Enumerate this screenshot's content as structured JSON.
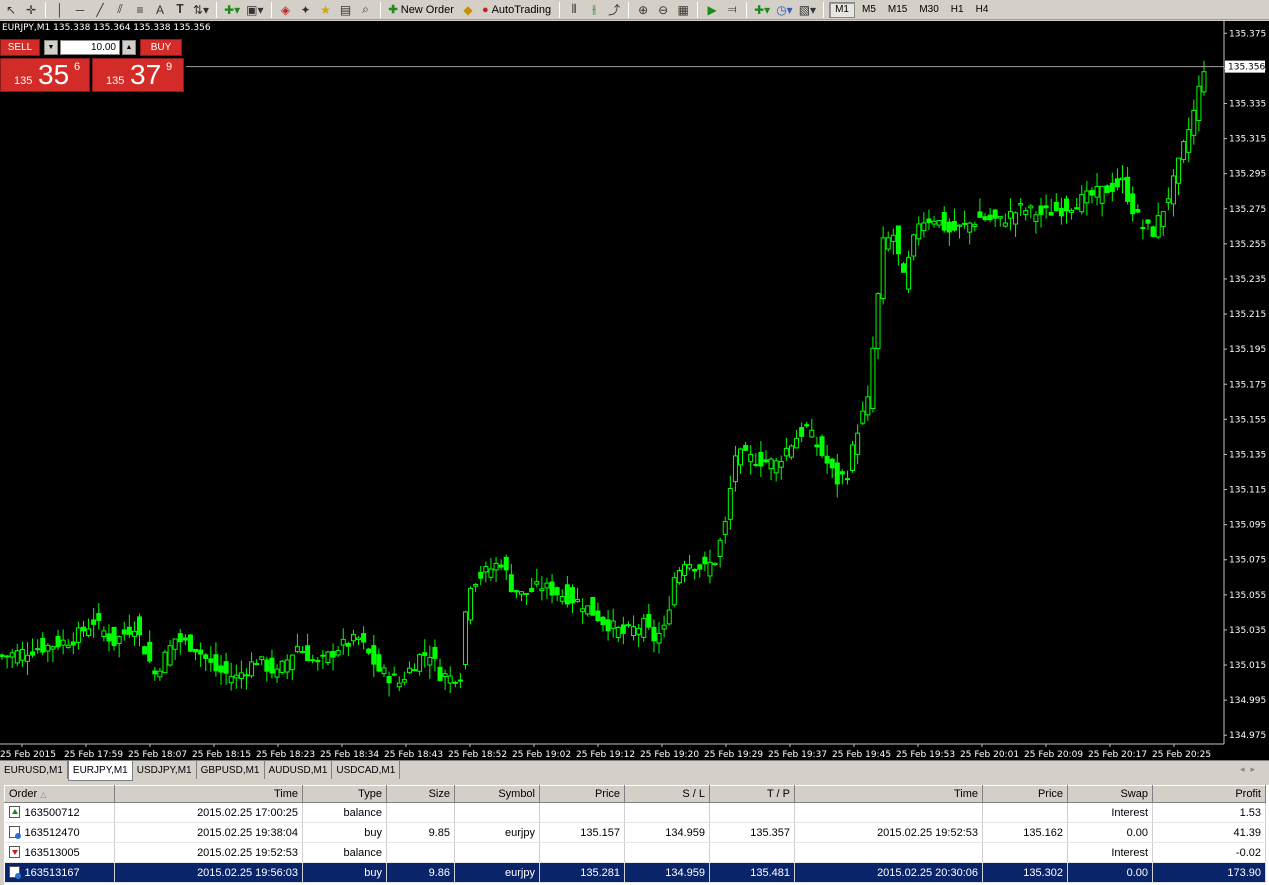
{
  "toolbar": {
    "new_order_label": "New Order",
    "autotrading_label": "AutoTrading",
    "timeframes": [
      "M1",
      "M5",
      "M15",
      "M30",
      "H1",
      "H4"
    ],
    "active_timeframe": "M1"
  },
  "chart": {
    "title_line": "EURJPY,M1  135.338 135.364 135.338 135.356",
    "current_price_label": "135.356",
    "background": "#000000",
    "candle_color": "#00ff00",
    "grid": false
  },
  "one_click": {
    "sell_label": "SELL",
    "buy_label": "BUY",
    "lot_value": "10.00",
    "sell_price": {
      "prefix": "135",
      "big": "35",
      "sup": "6"
    },
    "buy_price": {
      "prefix": "135",
      "big": "37",
      "sup": "9"
    },
    "button_color": "#d32b27"
  },
  "chart_data": {
    "type": "candlestick",
    "symbol": "EURJPY",
    "timeframe": "M1",
    "y_ticks": [
      "135.375",
      "135.355",
      "135.335",
      "135.315",
      "135.295",
      "135.275",
      "135.255",
      "135.235",
      "135.215",
      "135.195",
      "135.175",
      "135.155",
      "135.135",
      "135.115",
      "135.095",
      "135.075",
      "135.055",
      "135.035",
      "135.015",
      "134.995",
      "134.975"
    ],
    "ylim": [
      134.97,
      135.382
    ],
    "x_tick_labels": [
      "25 Feb 2015",
      "25 Feb 17:59",
      "25 Feb 18:07",
      "25 Feb 18:15",
      "25 Feb 18:23",
      "25 Feb 18:34",
      "25 Feb 18:43",
      "25 Feb 18:52",
      "25 Feb 19:02",
      "25 Feb 19:12",
      "25 Feb 19:20",
      "25 Feb 19:29",
      "25 Feb 19:37",
      "25 Feb 19:45",
      "25 Feb 19:53",
      "25 Feb 20:01",
      "25 Feb 20:09",
      "25 Feb 20:17",
      "25 Feb 20:25"
    ],
    "current_price": 135.356,
    "anchors": [
      [
        0,
        135.02
      ],
      [
        8,
        135.025
      ],
      [
        14,
        135.03
      ],
      [
        18,
        135.04
      ],
      [
        22,
        135.028
      ],
      [
        26,
        135.038
      ],
      [
        30,
        135.01
      ],
      [
        34,
        135.03
      ],
      [
        38,
        135.025
      ],
      [
        42,
        135.012
      ],
      [
        46,
        135.008
      ],
      [
        50,
        135.018
      ],
      [
        54,
        135.01
      ],
      [
        58,
        135.026
      ],
      [
        62,
        135.015
      ],
      [
        66,
        135.025
      ],
      [
        70,
        135.03
      ],
      [
        74,
        135.012
      ],
      [
        78,
        135.005
      ],
      [
        82,
        135.02
      ],
      [
        84,
        135.022
      ],
      [
        86,
        135.01
      ],
      [
        88,
        135.008
      ],
      [
        90,
        135.01
      ],
      [
        91,
        135.045
      ],
      [
        92,
        135.062
      ],
      [
        95,
        135.068
      ],
      [
        98,
        135.074
      ],
      [
        100,
        135.06
      ],
      [
        102,
        135.055
      ],
      [
        106,
        135.06
      ],
      [
        110,
        135.055
      ],
      [
        114,
        135.05
      ],
      [
        118,
        135.04
      ],
      [
        122,
        135.033
      ],
      [
        126,
        135.038
      ],
      [
        128,
        135.03
      ],
      [
        130,
        135.035
      ],
      [
        132,
        135.065
      ],
      [
        134,
        135.075
      ],
      [
        136,
        135.072
      ],
      [
        138,
        135.07
      ],
      [
        140,
        135.075
      ],
      [
        142,
        135.095
      ],
      [
        144,
        135.135
      ],
      [
        148,
        135.132
      ],
      [
        152,
        135.13
      ],
      [
        154,
        135.138
      ],
      [
        156,
        135.145
      ],
      [
        158,
        135.15
      ],
      [
        160,
        135.14
      ],
      [
        162,
        135.13
      ],
      [
        164,
        135.12
      ],
      [
        166,
        135.125
      ],
      [
        168,
        135.15
      ],
      [
        170,
        135.165
      ],
      [
        171,
        135.195
      ],
      [
        172,
        135.225
      ],
      [
        173,
        135.255
      ],
      [
        175,
        135.26
      ],
      [
        177,
        135.235
      ],
      [
        178,
        135.245
      ],
      [
        180,
        135.268
      ],
      [
        183,
        135.27
      ],
      [
        186,
        135.262
      ],
      [
        189,
        135.265
      ],
      [
        192,
        135.27
      ],
      [
        196,
        135.268
      ],
      [
        200,
        135.275
      ],
      [
        204,
        135.272
      ],
      [
        208,
        135.275
      ],
      [
        212,
        135.28
      ],
      [
        216,
        135.285
      ],
      [
        220,
        135.29
      ],
      [
        222,
        135.275
      ],
      [
        224,
        135.265
      ],
      [
        226,
        135.262
      ],
      [
        228,
        135.275
      ],
      [
        230,
        135.29
      ],
      [
        232,
        135.31
      ],
      [
        234,
        135.33
      ],
      [
        236,
        135.356
      ]
    ]
  },
  "terminal": {
    "tabs": [
      "EURUSD,M1",
      "EURJPY,M1",
      "USDJPY,M1",
      "GBPUSD,M1",
      "AUDUSD,M1",
      "USDCAD,M1"
    ],
    "active_tab": 1,
    "columns": [
      "Order",
      "Time",
      "Type",
      "Size",
      "Symbol",
      "Price",
      "S / L",
      "T / P",
      "Time",
      "Price",
      "Swap",
      "Profit"
    ],
    "rows": [
      {
        "icon": "bal-up",
        "order": "163500712",
        "time": "2015.02.25 17:00:25",
        "type": "balance",
        "size": "",
        "symbol": "",
        "price": "",
        "sl": "",
        "tp": "",
        "close_time": "",
        "close_price": "",
        "swap": "Interest",
        "profit": "1.53"
      },
      {
        "icon": "doc",
        "order": "163512470",
        "time": "2015.02.25 19:38:04",
        "type": "buy",
        "size": "9.85",
        "symbol": "eurjpy",
        "price": "135.157",
        "sl": "134.959",
        "tp": "135.357",
        "close_time": "2015.02.25 19:52:53",
        "close_price": "135.162",
        "swap": "0.00",
        "profit": "41.39"
      },
      {
        "icon": "bal-down",
        "order": "163513005",
        "time": "2015.02.25 19:52:53",
        "type": "balance",
        "size": "",
        "symbol": "",
        "price": "",
        "sl": "",
        "tp": "",
        "close_time": "",
        "close_price": "",
        "swap": "Interest",
        "profit": "-0.02"
      },
      {
        "icon": "doc",
        "order": "163513167",
        "time": "2015.02.25 19:56:03",
        "type": "buy",
        "size": "9.86",
        "symbol": "eurjpy",
        "price": "135.281",
        "sl": "134.959",
        "tp": "135.481",
        "close_time": "2015.02.25 20:30:06",
        "close_price": "135.302",
        "swap": "0.00",
        "profit": "173.90"
      }
    ],
    "selected_row": 3
  }
}
